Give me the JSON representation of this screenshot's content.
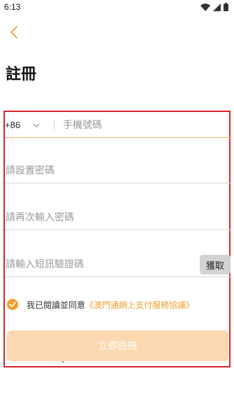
{
  "status_bar": {
    "time": "6:13",
    "icons": [
      "wifi-icon",
      "signal-icon",
      "battery-icon"
    ]
  },
  "header": {
    "back_icon": "chevron-left-icon",
    "title": "註冊"
  },
  "form": {
    "phone": {
      "country_code": "+86",
      "placeholder": "手機號碼"
    },
    "password": {
      "placeholder": "請設置密碼"
    },
    "password_confirm": {
      "placeholder": "請再次輸入密碼"
    },
    "verify_code": {
      "placeholder": "請輸入短訊驗證碼",
      "button_label": "獲取"
    },
    "agreement": {
      "checked": true,
      "text": "我已閱讀並同意",
      "link": "《澳門通網上支付服務協議》"
    },
    "submit_label": "立即註冊"
  },
  "colors": {
    "accent": "#f0a02f",
    "submit_bg": "#fbd8b0",
    "highlight_border": "#d8242b",
    "back_icon": "#f0a02f"
  }
}
